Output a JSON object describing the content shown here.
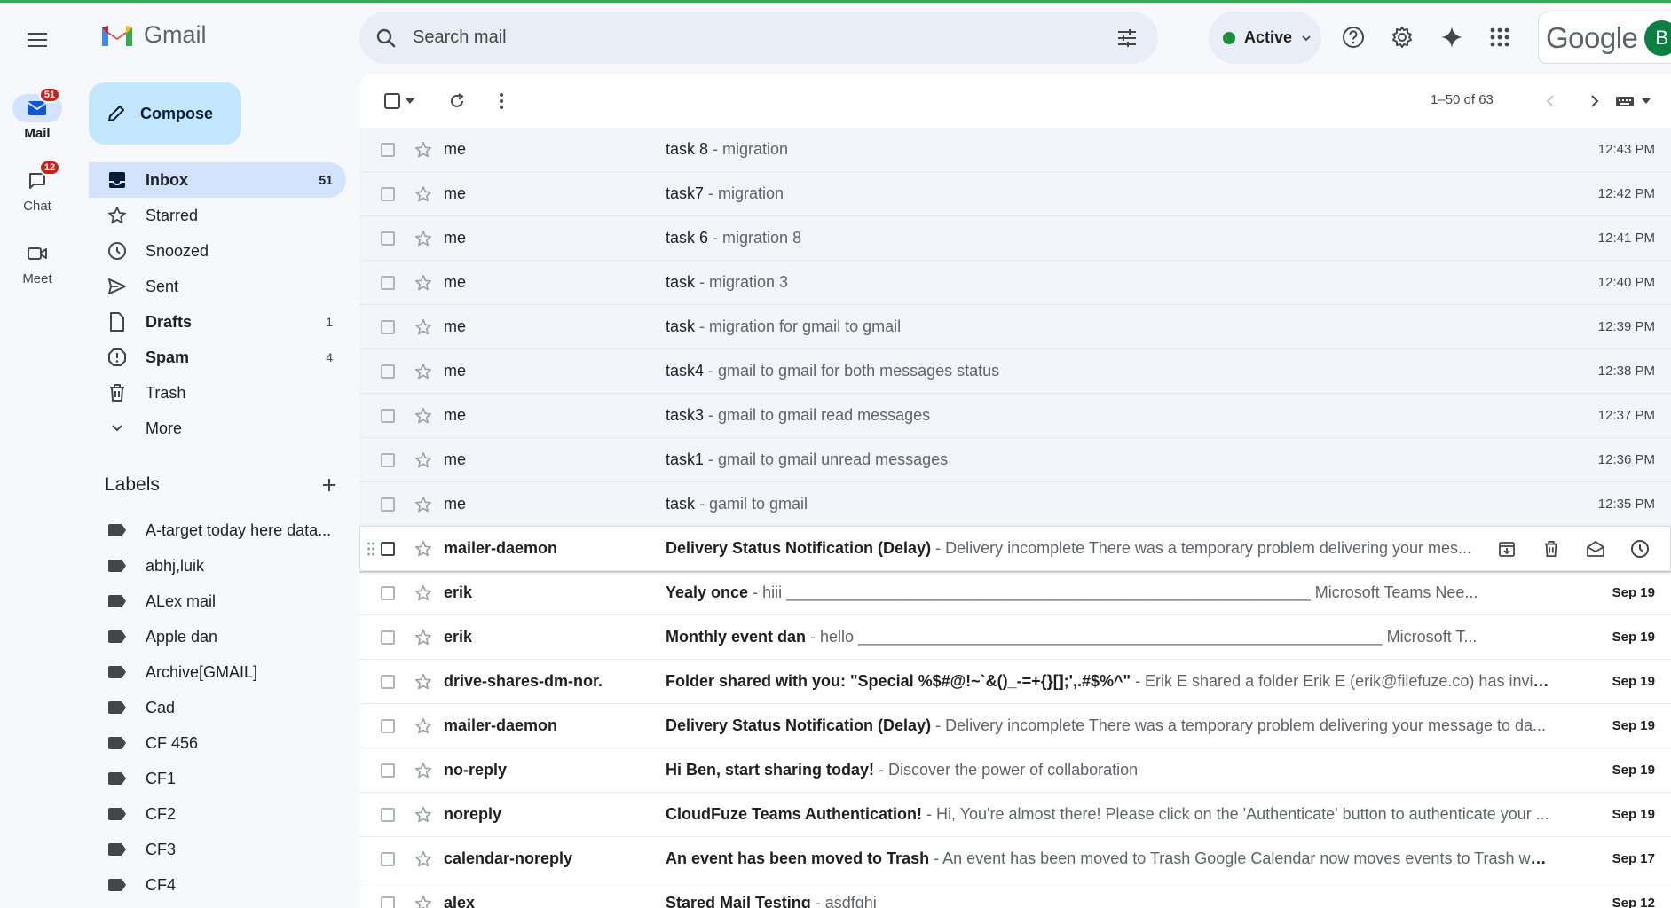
{
  "app": {
    "name": "Gmail"
  },
  "rail": [
    {
      "label": "Mail",
      "badge": "51",
      "icon": "mail-icon"
    },
    {
      "label": "Chat",
      "badge": "12",
      "icon": "chat-icon"
    },
    {
      "label": "Meet",
      "badge": "",
      "icon": "video-icon"
    }
  ],
  "search": {
    "placeholder": "Search mail"
  },
  "header": {
    "status": "Active",
    "brand": "Google",
    "avatar_letter": "B"
  },
  "compose": {
    "label": "Compose"
  },
  "nav": [
    {
      "label": "Inbox",
      "count": "51",
      "icon": "inbox-icon"
    },
    {
      "label": "Starred",
      "count": "",
      "icon": "star-icon"
    },
    {
      "label": "Snoozed",
      "count": "",
      "icon": "clock-icon"
    },
    {
      "label": "Sent",
      "count": "",
      "icon": "send-icon"
    },
    {
      "label": "Drafts",
      "count": "1",
      "icon": "draft-icon"
    },
    {
      "label": "Spam",
      "count": "4",
      "icon": "spam-icon"
    },
    {
      "label": "Trash",
      "count": "",
      "icon": "trash-icon"
    },
    {
      "label": "More",
      "count": "",
      "icon": "chevron-down-icon"
    }
  ],
  "labels": {
    "title": "Labels",
    "items": [
      "A-target today here data...",
      "abhj,luik",
      "ALex mail",
      "Apple dan",
      "Archive[GMAIL]",
      "Cad",
      "CF 456",
      "CF1",
      "CF2",
      "CF3",
      "CF4"
    ]
  },
  "toolbar": {
    "pager": "1–50 of 63"
  },
  "emails": [
    {
      "sender": "me",
      "subject": "task 8",
      "snippet": "migration",
      "date": "12:43 PM",
      "unread": false
    },
    {
      "sender": "me",
      "subject": "task7",
      "snippet": "migration",
      "date": "12:42 PM",
      "unread": false
    },
    {
      "sender": "me",
      "subject": "task 6",
      "snippet": "migration 8",
      "date": "12:41 PM",
      "unread": false
    },
    {
      "sender": "me",
      "subject": "task",
      "snippet": "migration 3",
      "date": "12:40 PM",
      "unread": false
    },
    {
      "sender": "me",
      "subject": "task",
      "snippet": "migration for gmail to gmail",
      "date": "12:39 PM",
      "unread": false
    },
    {
      "sender": "me",
      "subject": "task4",
      "snippet": "gmail to gmail for both messages status",
      "date": "12:38 PM",
      "unread": false
    },
    {
      "sender": "me",
      "subject": "task3",
      "snippet": "gmail to gmail read messages",
      "date": "12:37 PM",
      "unread": false
    },
    {
      "sender": "me",
      "subject": "task1",
      "snippet": "gmail to gmail unread messages",
      "date": "12:36 PM",
      "unread": false
    },
    {
      "sender": "me",
      "subject": "task",
      "snippet": "gamil to gmail",
      "date": "12:35 PM",
      "unread": false
    },
    {
      "sender": "mailer-daemon",
      "subject": "Delivery Status Notification (Delay)",
      "snippet": "Delivery incomplete There was a temporary problem delivering your mes...",
      "date": "",
      "unread": true,
      "hover": true
    },
    {
      "sender": "erik",
      "subject": "Yealy once",
      "snippet": "hiii ___________________________________________________________ Microsoft Teams Nee...",
      "date": "Sep 19",
      "unread": true
    },
    {
      "sender": "erik",
      "subject": "Monthly event dan",
      "snippet": "hello ___________________________________________________________ Microsoft T...",
      "date": "Sep 19",
      "unread": true
    },
    {
      "sender": "drive-shares-dm-nor.",
      "subject": "Folder shared with you: \"Special %$#@!~`&()_-=+{}[];',.#$%^\"",
      "snippet": "Erik E shared a folder Erik E (erik@filefuze.co) has invite...",
      "date": "Sep 19",
      "unread": true
    },
    {
      "sender": "mailer-daemon",
      "subject": "Delivery Status Notification (Delay)",
      "snippet": "Delivery incomplete There was a temporary problem delivering your message to da...",
      "date": "Sep 19",
      "unread": true
    },
    {
      "sender": "no-reply",
      "subject": "Hi Ben, start sharing today!",
      "snippet": "Discover the power of collaboration",
      "date": "Sep 19",
      "unread": true
    },
    {
      "sender": "noreply",
      "subject": "CloudFuze Teams Authentication!",
      "snippet": "Hi, You're almost there! Please click on the 'Authenticate' button to authenticate your ...",
      "date": "Sep 19",
      "unread": true
    },
    {
      "sender": "calendar-noreply",
      "subject": "An event has been moved to Trash",
      "snippet": "An event has been moved to Trash Google Calendar now moves events to Trash whe...",
      "date": "Sep 17",
      "unread": true
    },
    {
      "sender": "alex",
      "subject": "Stared Mail Testing",
      "snippet": "asdfghj",
      "date": "Sep 12",
      "unread": true
    }
  ],
  "colors": {
    "accent": "#0b57d0",
    "nav_active": "#d3e3fd",
    "compose": "#c2e7ff",
    "badge": "#c5221f"
  }
}
